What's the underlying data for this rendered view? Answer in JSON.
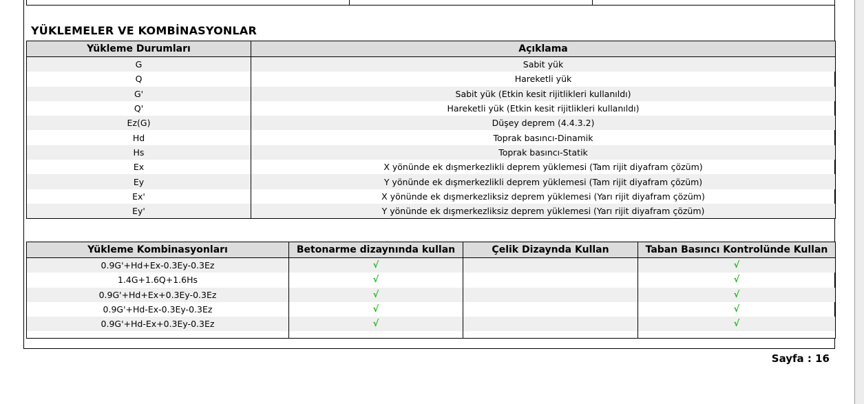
{
  "section_title": "YÜKLEMELER VE KOMBİNASYONLAR",
  "loads_table": {
    "headers": [
      "Yükleme Durumları",
      "Açıklama"
    ],
    "rows": [
      [
        "G",
        "Sabit yük"
      ],
      [
        "Q",
        "Hareketli yük"
      ],
      [
        "G'",
        "Sabit yük (Etkin kesit rijitlikleri kullanıldı)"
      ],
      [
        "Q'",
        "Hareketli yük (Etkin kesit rijitlikleri kullanıldı)"
      ],
      [
        "Ez(G)",
        "Düşey deprem (4.4.3.2)"
      ],
      [
        "Hd",
        "Toprak basıncı-Dinamik"
      ],
      [
        "Hs",
        "Toprak basıncı-Statik"
      ],
      [
        "Ex",
        "X yönünde ek dışmerkezlikli deprem yüklemesi (Tam rijit diyafram çözüm)"
      ],
      [
        "Ey",
        "Y yönünde ek dışmerkezlikli deprem yüklemesi (Tam rijit diyafram çözüm)"
      ],
      [
        "Ex'",
        "X yönünde ek dışmerkezliksiz deprem yüklemesi (Yarı rijit diyafram çözüm)"
      ],
      [
        "Ey'",
        "Y yönünde ek dışmerkezliksiz deprem yüklemesi (Yarı rijit diyafram çözüm)"
      ]
    ]
  },
  "combos_table": {
    "headers": [
      "Yükleme Kombinasyonları",
      "Betonarme dizaynında kullan",
      "Çelik  Dizaynda Kullan",
      "Taban Basıncı Kontrolünde Kullan"
    ],
    "rows": [
      [
        "0.9G'+Hd+Ex-0.3Ey-0.3Ez",
        "√",
        "",
        "√"
      ],
      [
        "1.4G+1.6Q+1.6Hs",
        "√",
        "",
        "√"
      ],
      [
        "0.9G'+Hd+Ex+0.3Ey-0.3Ez",
        "√",
        "",
        "√"
      ],
      [
        "0.9G'+Hd-Ex-0.3Ey-0.3Ez",
        "√",
        "",
        "√"
      ],
      [
        "0.9G'+Hd-Ex+0.3Ey-0.3Ez",
        "√",
        "",
        "√"
      ]
    ]
  },
  "footer": {
    "page_label": "Sayfa : 16"
  }
}
